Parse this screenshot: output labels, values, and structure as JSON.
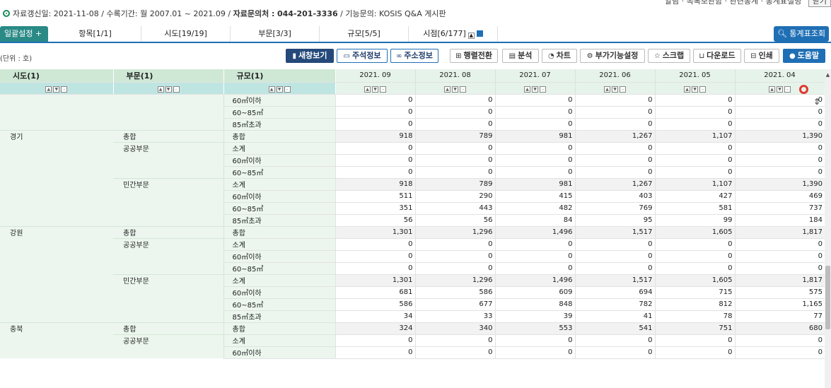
{
  "top": {
    "cut_text": "알림 · 목록보관함 · 관련통계 · 통계표설명",
    "cut_button": "닫기"
  },
  "info": {
    "updated": "자료갱신일: 2021-11-08",
    "period": "수록기간: 월 2007.01 ~ 2021.09",
    "contact_label": "자료문의처 :",
    "contact_phone": "044-201-3336",
    "feature": "기능문의: KOSIS Q&A 게시판"
  },
  "tabs": {
    "main": "일괄설정",
    "items": [
      "항목[1/1]",
      "시도[19/19]",
      "부문[3/3]",
      "규모[5/5]",
      "시점[6/177]"
    ],
    "stat_button": "통계표조회"
  },
  "toolbar": {
    "unit": "(단위 : 호)",
    "buttons": [
      "새창보기",
      "주석정보",
      "주소정보",
      "행렬전환",
      "분석",
      "차트",
      "부가기능설정",
      "스크랩",
      "다운로드",
      "인쇄",
      "도움말"
    ]
  },
  "table": {
    "headers": [
      "시도(1)",
      "부문(1)",
      "규모(1)"
    ],
    "dates": [
      "2021. 09",
      "2021. 08",
      "2021. 07",
      "2021. 06",
      "2021. 05",
      "2021. 04"
    ],
    "rows": [
      {
        "c1": "",
        "c2": "",
        "c3": "60㎡이하",
        "v": [
          "0",
          "0",
          "0",
          "0",
          "0",
          "0"
        ]
      },
      {
        "c1": "",
        "c2": "",
        "c3": "60~85㎡",
        "v": [
          "0",
          "0",
          "0",
          "0",
          "0",
          "0"
        ]
      },
      {
        "c1": "",
        "c2": "",
        "c3": "85㎡초과",
        "v": [
          "0",
          "0",
          "0",
          "0",
          "0",
          "0"
        ]
      },
      {
        "c1": "경기",
        "c2": "총합",
        "c3": "총합",
        "v": [
          "918",
          "789",
          "981",
          "1,267",
          "1,107",
          "1,390"
        ]
      },
      {
        "c1": "",
        "c2": "공공부문",
        "c3": "소계",
        "v": [
          "0",
          "0",
          "0",
          "0",
          "0",
          "0"
        ]
      },
      {
        "c1": "",
        "c2": "",
        "c3": "60㎡이하",
        "v": [
          "0",
          "0",
          "0",
          "0",
          "0",
          "0"
        ]
      },
      {
        "c1": "",
        "c2": "",
        "c3": "60~85㎡",
        "v": [
          "0",
          "0",
          "0",
          "0",
          "0",
          "0"
        ]
      },
      {
        "c1": "",
        "c2": "민간부문",
        "c3": "소계",
        "v": [
          "918",
          "789",
          "981",
          "1,267",
          "1,107",
          "1,390"
        ]
      },
      {
        "c1": "",
        "c2": "",
        "c3": "60㎡이하",
        "v": [
          "511",
          "290",
          "415",
          "403",
          "427",
          "469"
        ]
      },
      {
        "c1": "",
        "c2": "",
        "c3": "60~85㎡",
        "v": [
          "351",
          "443",
          "482",
          "769",
          "581",
          "737"
        ]
      },
      {
        "c1": "",
        "c2": "",
        "c3": "85㎡초과",
        "v": [
          "56",
          "56",
          "84",
          "95",
          "99",
          "184"
        ]
      },
      {
        "c1": "강원",
        "c2": "총합",
        "c3": "총합",
        "v": [
          "1,301",
          "1,296",
          "1,496",
          "1,517",
          "1,605",
          "1,817"
        ]
      },
      {
        "c1": "",
        "c2": "공공부문",
        "c3": "소계",
        "v": [
          "0",
          "0",
          "0",
          "0",
          "0",
          "0"
        ]
      },
      {
        "c1": "",
        "c2": "",
        "c3": "60㎡이하",
        "v": [
          "0",
          "0",
          "0",
          "0",
          "0",
          "0"
        ]
      },
      {
        "c1": "",
        "c2": "",
        "c3": "60~85㎡",
        "v": [
          "0",
          "0",
          "0",
          "0",
          "0",
          "0"
        ]
      },
      {
        "c1": "",
        "c2": "민간부문",
        "c3": "소계",
        "v": [
          "1,301",
          "1,296",
          "1,496",
          "1,517",
          "1,605",
          "1,817"
        ]
      },
      {
        "c1": "",
        "c2": "",
        "c3": "60㎡이하",
        "v": [
          "681",
          "586",
          "609",
          "694",
          "715",
          "575"
        ]
      },
      {
        "c1": "",
        "c2": "",
        "c3": "60~85㎡",
        "v": [
          "586",
          "677",
          "848",
          "782",
          "812",
          "1,165"
        ]
      },
      {
        "c1": "",
        "c2": "",
        "c3": "85㎡초과",
        "v": [
          "34",
          "33",
          "39",
          "41",
          "78",
          "77"
        ]
      },
      {
        "c1": "충북",
        "c2": "총합",
        "c3": "총합",
        "v": [
          "324",
          "340",
          "553",
          "541",
          "751",
          "680"
        ]
      },
      {
        "c1": "",
        "c2": "공공부문",
        "c3": "소계",
        "v": [
          "0",
          "0",
          "0",
          "0",
          "0",
          "0"
        ]
      },
      {
        "c1": "",
        "c2": "",
        "c3": "60㎡이하",
        "v": [
          "0",
          "0",
          "0",
          "0",
          "0",
          "0"
        ]
      }
    ]
  }
}
